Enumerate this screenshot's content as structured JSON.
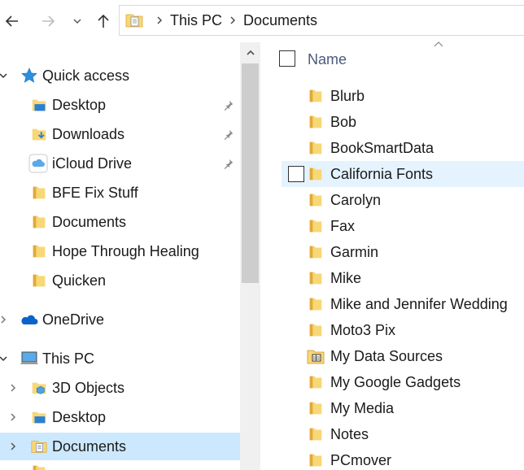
{
  "address_bar": {
    "crumbs": [
      "This PC",
      "Documents"
    ]
  },
  "nav_pane": {
    "quick_access": {
      "label": "Quick access",
      "items": [
        {
          "label": "Desktop",
          "icon": "desktop-folder-icon",
          "pinned": true
        },
        {
          "label": "Downloads",
          "icon": "downloads-folder-icon",
          "pinned": true
        },
        {
          "label": "iCloud Drive",
          "icon": "icloud-icon",
          "pinned": true
        },
        {
          "label": "BFE Fix Stuff",
          "icon": "folder-icon",
          "pinned": false
        },
        {
          "label": "Documents",
          "icon": "folder-icon",
          "pinned": false
        },
        {
          "label": "Hope Through Healing",
          "icon": "folder-icon",
          "pinned": false
        },
        {
          "label": "Quicken",
          "icon": "folder-icon",
          "pinned": false
        }
      ]
    },
    "onedrive": {
      "label": "OneDrive"
    },
    "this_pc": {
      "label": "This PC",
      "items": [
        {
          "label": "3D Objects",
          "icon": "3d-objects-icon"
        },
        {
          "label": "Desktop",
          "icon": "desktop-folder-icon"
        },
        {
          "label": "Documents",
          "icon": "documents-folder-icon",
          "selected": true
        }
      ]
    }
  },
  "content": {
    "column_header": {
      "name": "Name"
    },
    "files": [
      {
        "name": "Blurb",
        "icon": "folder-icon"
      },
      {
        "name": "Bob",
        "icon": "folder-icon"
      },
      {
        "name": "BookSmartData",
        "icon": "folder-icon"
      },
      {
        "name": "California Fonts",
        "icon": "folder-icon",
        "hover": true
      },
      {
        "name": "Carolyn",
        "icon": "folder-icon"
      },
      {
        "name": "Fax",
        "icon": "folder-icon"
      },
      {
        "name": "Garmin",
        "icon": "folder-icon"
      },
      {
        "name": "Mike",
        "icon": "folder-icon"
      },
      {
        "name": "Mike and Jennifer Wedding",
        "icon": "folder-icon"
      },
      {
        "name": "Moto3 Pix",
        "icon": "folder-icon"
      },
      {
        "name": "My Data Sources",
        "icon": "data-sources-folder-icon"
      },
      {
        "name": "My Google Gadgets",
        "icon": "folder-icon"
      },
      {
        "name": "My Media",
        "icon": "folder-icon"
      },
      {
        "name": "Notes",
        "icon": "folder-icon"
      },
      {
        "name": "PCmover",
        "icon": "folder-icon"
      }
    ]
  },
  "colors": {
    "selected_row": "#cce8ff",
    "hover_row": "#e5f3ff",
    "folder_yellow": "#f8d775",
    "folder_dark": "#e0a93a",
    "accent_blue": "#0078d7"
  }
}
